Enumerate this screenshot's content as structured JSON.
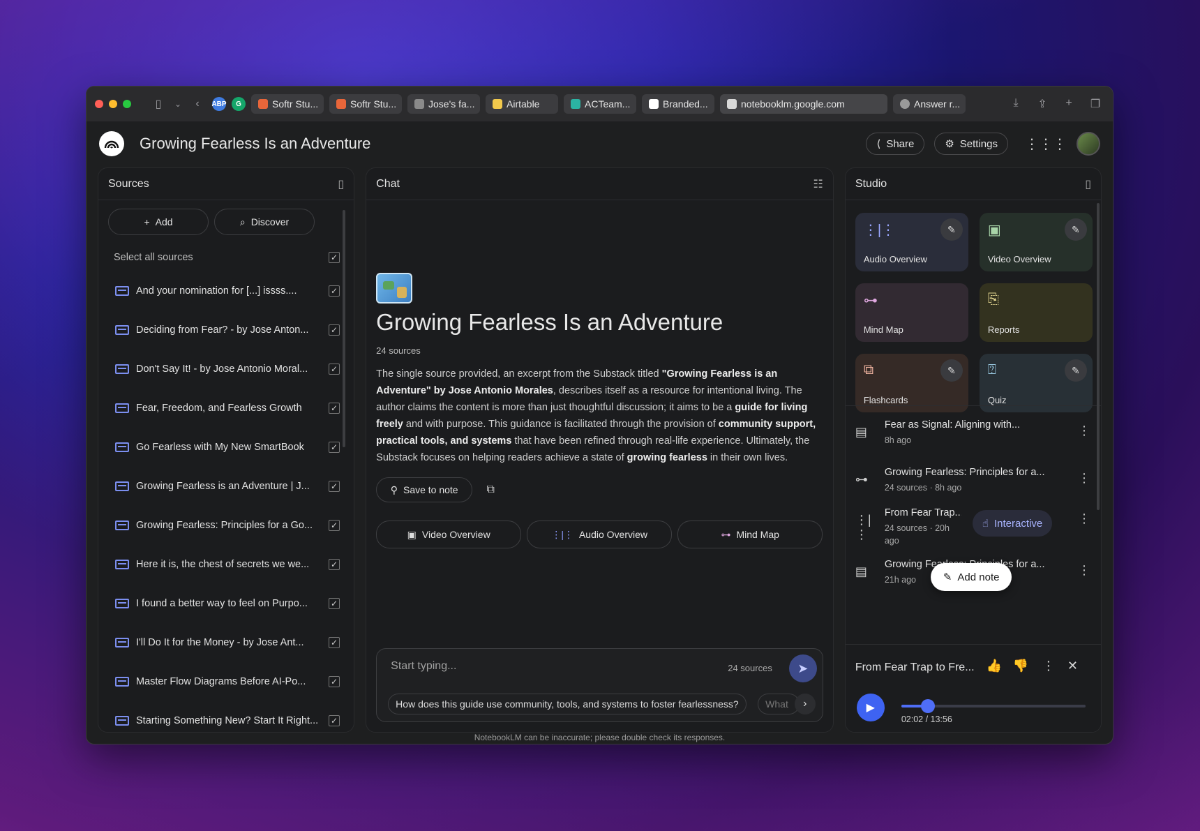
{
  "browser": {
    "tabs": [
      {
        "label": "Softr Stu...",
        "color": "#e8663a"
      },
      {
        "label": "Softr Stu...",
        "color": "#e8663a"
      },
      {
        "label": "Jose's fa...",
        "color": "#8a8a8a"
      },
      {
        "label": "Airtable",
        "color": "#f2c94c"
      },
      {
        "label": "ACTeam...",
        "color": "#2bb3a3"
      },
      {
        "label": "Branded...",
        "color": "#ffffff"
      },
      {
        "label": "notebooklm.google.com",
        "color": "#d9d9d9"
      },
      {
        "label": "Answer r...",
        "color": "#9a9a9a"
      }
    ]
  },
  "app": {
    "title": "Growing Fearless Is an Adventure",
    "share_label": "Share",
    "settings_label": "Settings"
  },
  "sources": {
    "header": "Sources",
    "add_label": "Add",
    "discover_label": "Discover",
    "select_all_label": "Select all sources",
    "items": [
      "And your nomination for [...] issss....",
      "Deciding from Fear? - by Jose Anton...",
      "Don't Say It! - by Jose Antonio Moral...",
      "Fear, Freedom, and Fearless Growth",
      "Go Fearless with My New SmartBook",
      "Growing Fearless is an Adventure | J...",
      "Growing Fearless: Principles for a Go...",
      "Here it is, the chest of secrets we we...",
      "I found a better way to feel on Purpo...",
      "I'll Do It for the Money - by Jose Ant...",
      "Master Flow Diagrams Before AI-Po...",
      "Starting Something New? Start It Right..."
    ]
  },
  "chat": {
    "header": "Chat",
    "title": "Growing Fearless Is an Adventure",
    "source_count": "24 sources",
    "summary_parts": {
      "p1": "The single source provided, an excerpt from the Substack titled ",
      "b1": "\"Growing Fearless is an Adventure\" by Jose Antonio Morales",
      "p2": ", describes itself as a resource for intentional living. The author claims the content is more than just thoughtful discussion; it aims to be a ",
      "b2": "guide for living freely",
      "p3": " and with purpose. This guidance is facilitated through the provision of ",
      "b3": "community support, practical tools, and systems",
      "p4": " that have been refined through real-life experience. Ultimately, the Substack focuses on helping readers achieve a state of ",
      "b4": "growing fearless",
      "p5": " in their own lives."
    },
    "save_note_label": "Save to note",
    "overview_buttons": [
      "Video Overview",
      "Audio Overview",
      "Mind Map"
    ],
    "composer": {
      "placeholder": "Start typing...",
      "source_count": "24 sources",
      "suggestion": "How does this guide use community, tools, and systems to foster fearlessness?",
      "suggestion_next": "What"
    },
    "disclaimer": "NotebookLM can be inaccurate; please double check its responses."
  },
  "studio": {
    "header": "Studio",
    "tiles": [
      {
        "label": "Audio Overview",
        "bg": "#2a2d3a",
        "icon_color": "#9aa7ff"
      },
      {
        "label": "Video Overview",
        "bg": "#26302a",
        "icon_color": "#a8d4a8"
      },
      {
        "label": "Mind Map",
        "bg": "#322a32",
        "icon_color": "#e0a8e0"
      },
      {
        "label": "Reports",
        "bg": "#33321f",
        "icon_color": "#e2d590"
      },
      {
        "label": "Flashcards",
        "bg": "#352a26",
        "icon_color": "#f0b4a0"
      },
      {
        "label": "Quiz",
        "bg": "#283036",
        "icon_color": "#9ecfe8"
      }
    ],
    "notes": [
      {
        "title": "Fear as Signal: Aligning with...",
        "sub": "8h ago"
      },
      {
        "title": "Growing Fearless: Principles for a...",
        "sub": "24 sources · 8h ago"
      },
      {
        "title": "From Fear Trap...",
        "sub": "24 sources · 20h ago"
      },
      {
        "title": "Growing Fearless: Principles for a...",
        "sub": "21h ago"
      }
    ],
    "interactive_label": "Interactive",
    "add_note_label": "Add note",
    "player": {
      "title": "From Fear Trap to Fre...",
      "time": "02:02 / 13:56",
      "progress": 0.146
    }
  }
}
